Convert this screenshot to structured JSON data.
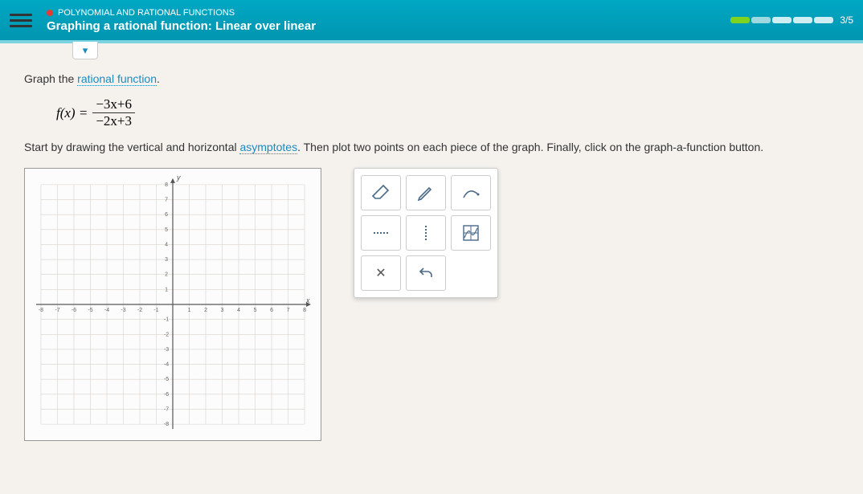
{
  "header": {
    "breadcrumb": "POLYNOMIAL AND RATIONAL FUNCTIONS",
    "title": "Graphing a rational function: Linear over linear",
    "progress_label": "3/5"
  },
  "prompt": {
    "lead": "Graph the ",
    "term": "rational function",
    "tail": "."
  },
  "formula": {
    "lhs": "f(x) =",
    "numerator": "−3x+6",
    "denominator": "−2x+3"
  },
  "instructions": {
    "p1": "Start by drawing the vertical and horizontal ",
    "term": "asymptotes",
    "p2": ". Then plot two points on each piece of the graph. Finally, click on the graph-a-function button."
  },
  "tools": {
    "eraser": "eraser",
    "pencil": "pencil",
    "curve": "curve",
    "solid_line": "solid-asymptote",
    "dashed_line": "dashed-asymptote",
    "graph_fn": "graph-a-function",
    "clear": "clear",
    "undo": "undo"
  },
  "chart_data": {
    "type": "scatter",
    "title": "",
    "xlabel": "x",
    "ylabel": "y",
    "xlim": [
      -8,
      8
    ],
    "ylim": [
      -8,
      8
    ],
    "xticks": [
      -8,
      -7,
      -6,
      -5,
      -4,
      -3,
      -2,
      -1,
      1,
      2,
      3,
      4,
      5,
      6,
      7,
      8
    ],
    "yticks": [
      -8,
      -7,
      -6,
      -5,
      -4,
      -3,
      -2,
      -1,
      1,
      2,
      3,
      4,
      5,
      6,
      7,
      8
    ],
    "series": []
  }
}
